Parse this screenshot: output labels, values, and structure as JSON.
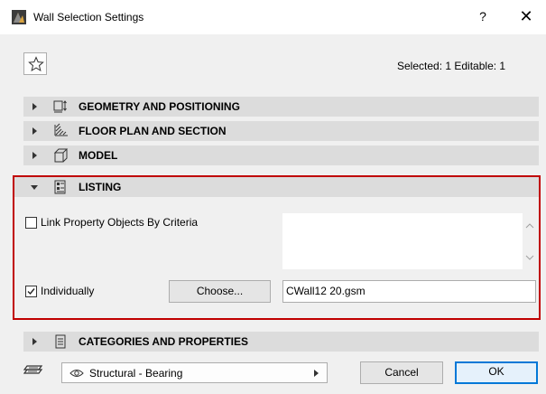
{
  "window": {
    "title": "Wall Selection Settings",
    "help_label": "?",
    "close_label": "✕"
  },
  "toolbar": {
    "selected_info": "Selected: 1 Editable: 1"
  },
  "panels": [
    {
      "title": "GEOMETRY AND POSITIONING",
      "expanded": false,
      "icon": "geometry-icon"
    },
    {
      "title": "FLOOR PLAN AND SECTION",
      "expanded": false,
      "icon": "floor-plan-icon"
    },
    {
      "title": "MODEL",
      "expanded": false,
      "icon": "model-box-icon"
    },
    {
      "title": "LISTING",
      "expanded": true,
      "icon": "listing-icon"
    },
    {
      "title": "CATEGORIES AND PROPERTIES",
      "expanded": false,
      "icon": "categories-icon"
    }
  ],
  "listing": {
    "link_criteria_label": "Link Property Objects By Criteria",
    "link_criteria_checked": false,
    "individually_label": "Individually",
    "individually_checked": true,
    "choose_label": "Choose...",
    "file_value": "CWall12 20.gsm"
  },
  "footer": {
    "layer_value": "Structural - Bearing",
    "cancel_label": "Cancel",
    "ok_label": "OK"
  },
  "colors": {
    "highlight": "#c00000",
    "panel_header": "#dcdcdc",
    "dialog_bg": "#f0f0f0",
    "ok_border": "#0078d7"
  }
}
